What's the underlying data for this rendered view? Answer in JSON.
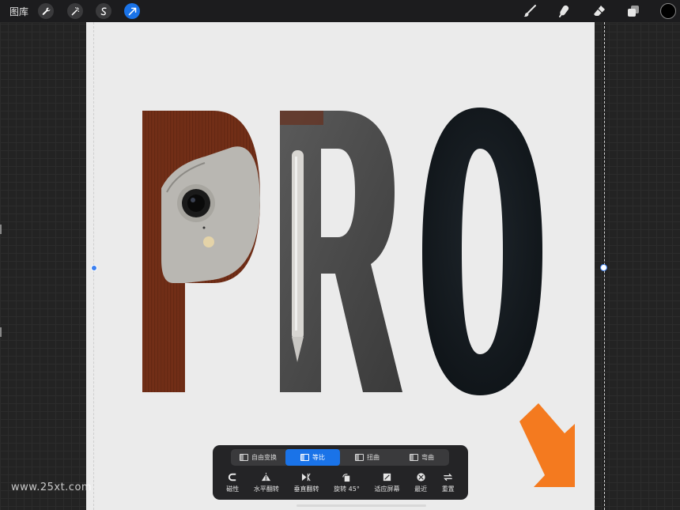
{
  "topbar": {
    "gallery_label": "图库",
    "left_icons": [
      "wrench-icon",
      "magic-wand-icon",
      "selection-icon",
      "transform-arrow-icon"
    ],
    "right_icons": [
      "brush-icon",
      "smudge-icon",
      "eraser-icon",
      "layers-icon",
      "color-well"
    ],
    "active_color": "#000000",
    "accent": "#1a73e8"
  },
  "canvas": {
    "artwork_text": "PRO",
    "background": "#ebebeb"
  },
  "transform_panel": {
    "modes": [
      {
        "label": "自由变换",
        "selected": false
      },
      {
        "label": "等比",
        "selected": true
      },
      {
        "label": "扭曲",
        "selected": false
      },
      {
        "label": "弯曲",
        "selected": false
      }
    ],
    "tools": [
      {
        "label": "磁性",
        "icon": "magnet-icon"
      },
      {
        "label": "水平翻转",
        "icon": "flip-horizontal-icon"
      },
      {
        "label": "垂直翻转",
        "icon": "flip-vertical-icon"
      },
      {
        "label": "旋转 45°",
        "icon": "rotate-icon"
      },
      {
        "label": "适应屏幕",
        "icon": "fit-screen-icon"
      },
      {
        "label": "最近",
        "icon": "recent-icon"
      },
      {
        "label": "重置",
        "icon": "reset-icon"
      }
    ]
  },
  "watermark": "www.25xt.com"
}
